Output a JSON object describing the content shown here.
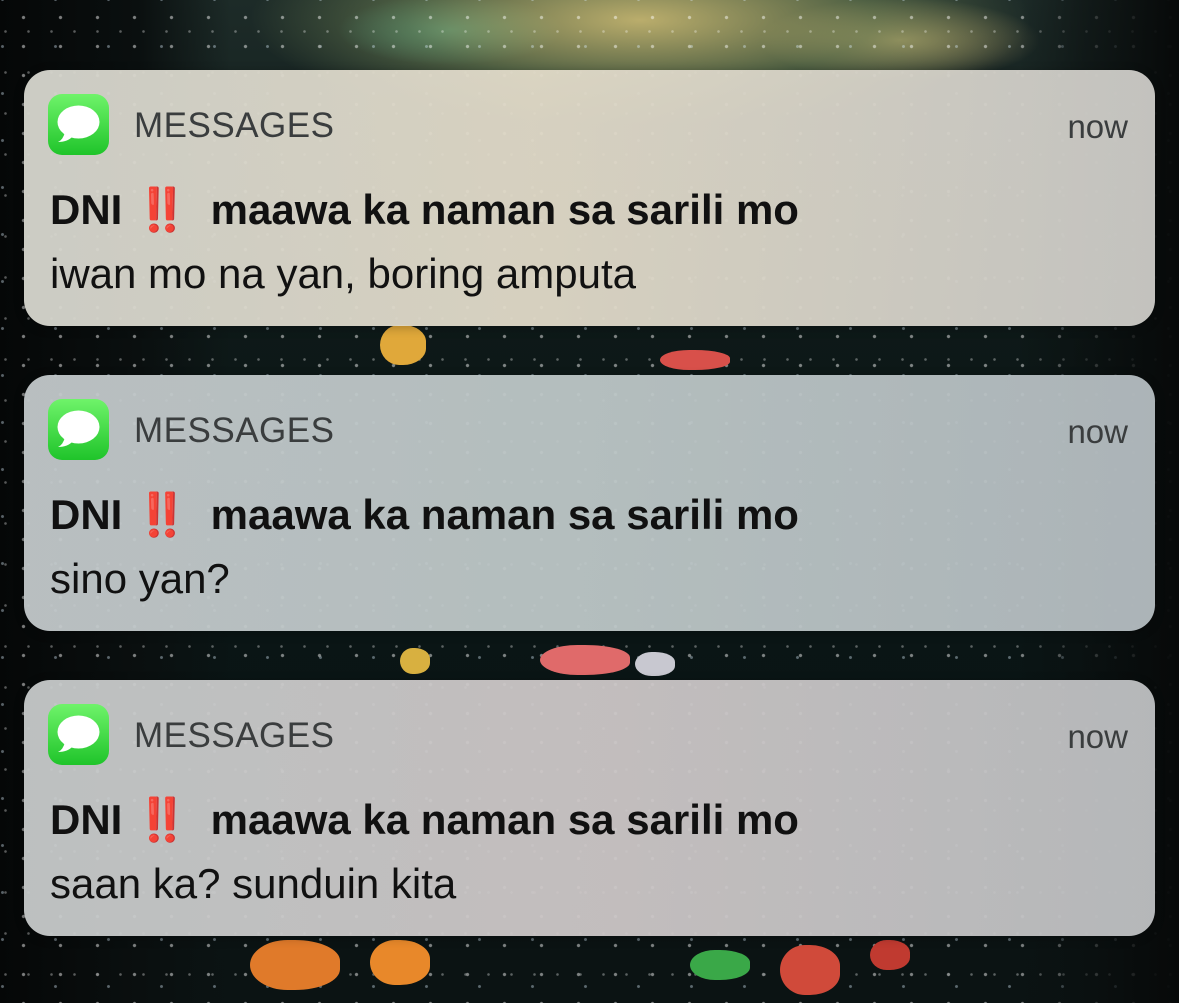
{
  "notifications": [
    {
      "app_name": "MESSAGES",
      "time": "now",
      "sender": "DNI",
      "sender_emoji": "‼️",
      "sender_suffix": "maawa ka naman sa sarili mo",
      "message": "iwan mo na yan, boring amputa",
      "icon": "messages-app-icon"
    },
    {
      "app_name": "MESSAGES",
      "time": "now",
      "sender": "DNI",
      "sender_emoji": "‼️",
      "sender_suffix": "maawa ka naman sa sarili mo",
      "message": "sino yan?",
      "icon": "messages-app-icon"
    },
    {
      "app_name": "MESSAGES",
      "time": "now",
      "sender": "DNI",
      "sender_emoji": "‼️",
      "sender_suffix": "maawa ka naman sa sarili mo",
      "message": "saan ka? sunduin kita",
      "icon": "messages-app-icon"
    }
  ],
  "colors": {
    "icon_green_top": "#6ff36a",
    "icon_green_bottom": "#1fc42a",
    "emoji_red": "#e8261b"
  }
}
